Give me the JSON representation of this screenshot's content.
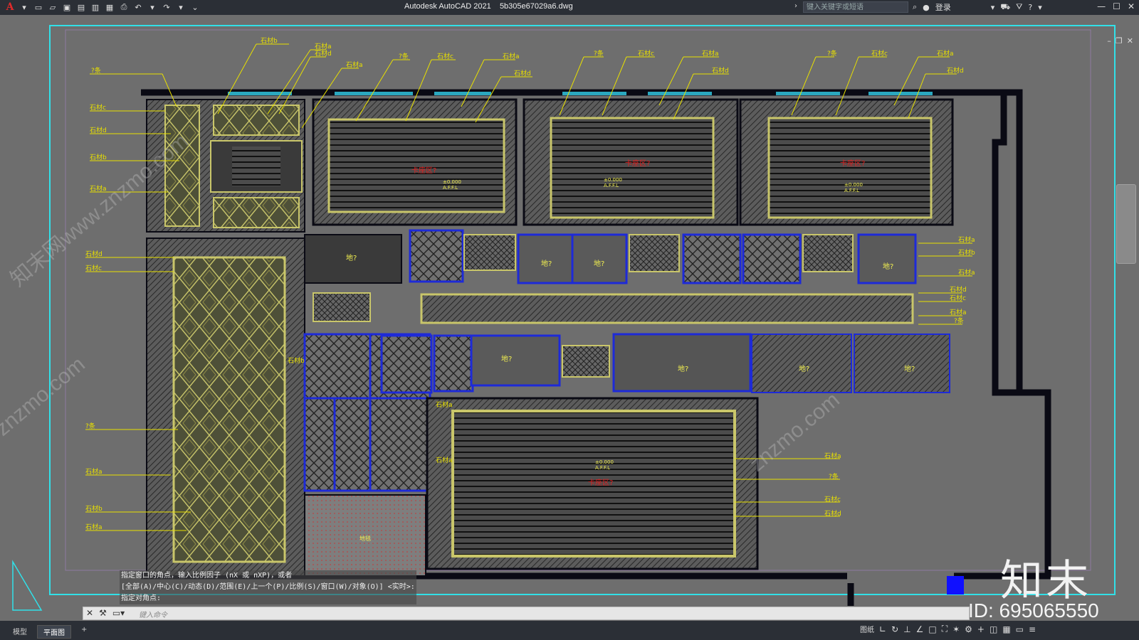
{
  "app": {
    "title": "Autodesk AutoCAD 2021",
    "filename": "5b305e67029a6.dwg"
  },
  "titlebar": {
    "search_placeholder": "键入关键字或短语",
    "login_label": "登录"
  },
  "drawing": {
    "labels": {
      "shi_a": "石材a",
      "shi_b": "石材b",
      "shi_c": "石材c",
      "shi_d": "石材d",
      "q_tiao": "?条",
      "di": "地?",
      "room_red": "卡座区?",
      "elev": "±0.000",
      "affl": "A.F.F.L",
      "ditan": "地毯"
    }
  },
  "command": {
    "history": [
      "指定窗口的角点，输入比例因子 (nX 或 nXP)，或者",
      "[全部(A)/中心(C)/动态(D)/范围(E)/上一个(P)/比例(S)/窗口(W)/对象(O)] <实时>:",
      "指定对角点:"
    ],
    "placeholder": "键入命令"
  },
  "status": {
    "tabs": [
      "模型",
      "平面图"
    ],
    "add_tab": "+",
    "paper_label": "图纸"
  },
  "watermark": {
    "brand": "知末",
    "id": "ID: 695065550",
    "diag1": "知末网www.znzmo.com",
    "diag2": "znzmo.com"
  },
  "colors": {
    "background": "#6e6e6e",
    "titlebar": "#2b2f36",
    "cyan_border": "#31e0e8",
    "wall": "#0a0a14",
    "annotation": "#e8e000",
    "blue_outline": "#1d2ad8",
    "red_text": "#e02020"
  }
}
